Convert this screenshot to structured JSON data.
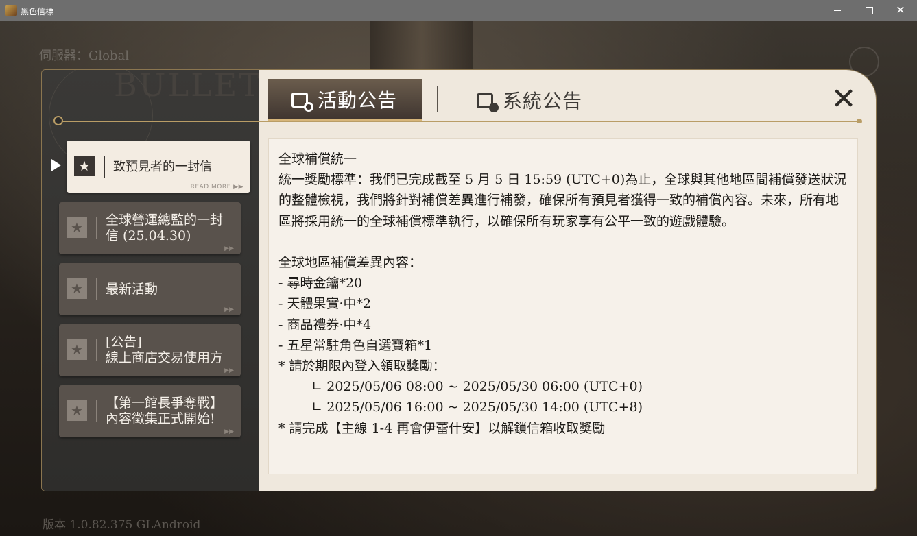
{
  "window": {
    "title": "黑色信標"
  },
  "background": {
    "server_label": "伺服器：Global",
    "bullet_text": "BULLET",
    "version_label": "版本 1.0.82.375 GLAndroid"
  },
  "tabs": [
    {
      "label": "活動公告",
      "icon": "calendar-clock-icon",
      "active": true
    },
    {
      "label": "系統公告",
      "icon": "calendar-gear-icon",
      "active": false
    }
  ],
  "sidebar": {
    "items": [
      {
        "label": "致預見者的一封信",
        "badge": "READ MORE ▶▶",
        "active": true
      },
      {
        "label": "全球營運總監的一封\n信 (25.04.30)",
        "badge": "▶▶",
        "active": false
      },
      {
        "label": "最新活動",
        "badge": "▶▶",
        "active": false
      },
      {
        "label": "[公告]\n線上商店交易使用方",
        "badge": "▶▶",
        "active": false
      },
      {
        "label": "【第一館長爭奪戰】\n內容徵集正式開始!",
        "badge": "▶▶",
        "active": false
      }
    ]
  },
  "content": {
    "body": "全球補償統一\n統一獎勵標準：我們已完成截至 5 月 5 日 15:59 (UTC+0)為止，全球與其他地區間補償發送狀況的整體檢視，我們將針對補償差異進行補發，確保所有預見者獲得一致的補償內容。未來，所有地區將採用統一的全球補償標準執行，以確保所有玩家享有公平一致的遊戲體驗。\n\n全球地區補償差異內容：\n- 尋時金鑰*20\n- 天體果實·中*2\n- 商品禮券·中*4\n- 五星常駐角色自選寶箱*1\n* 請於期限內登入領取獎勵：\n        ∟ 2025/05/06 08:00 ~ 2025/05/30 06:00 (UTC+0)\n        ∟ 2025/05/06 16:00 ~ 2025/05/30 14:00 (UTC+8)\n* 請完成【主線 1-4 再會伊蕾什安】以解鎖信箱收取獎勵"
  },
  "colors": {
    "accent_gold": "#b99d66",
    "panel_cream": "#efe8dd",
    "tab_active": "#4e4239"
  }
}
